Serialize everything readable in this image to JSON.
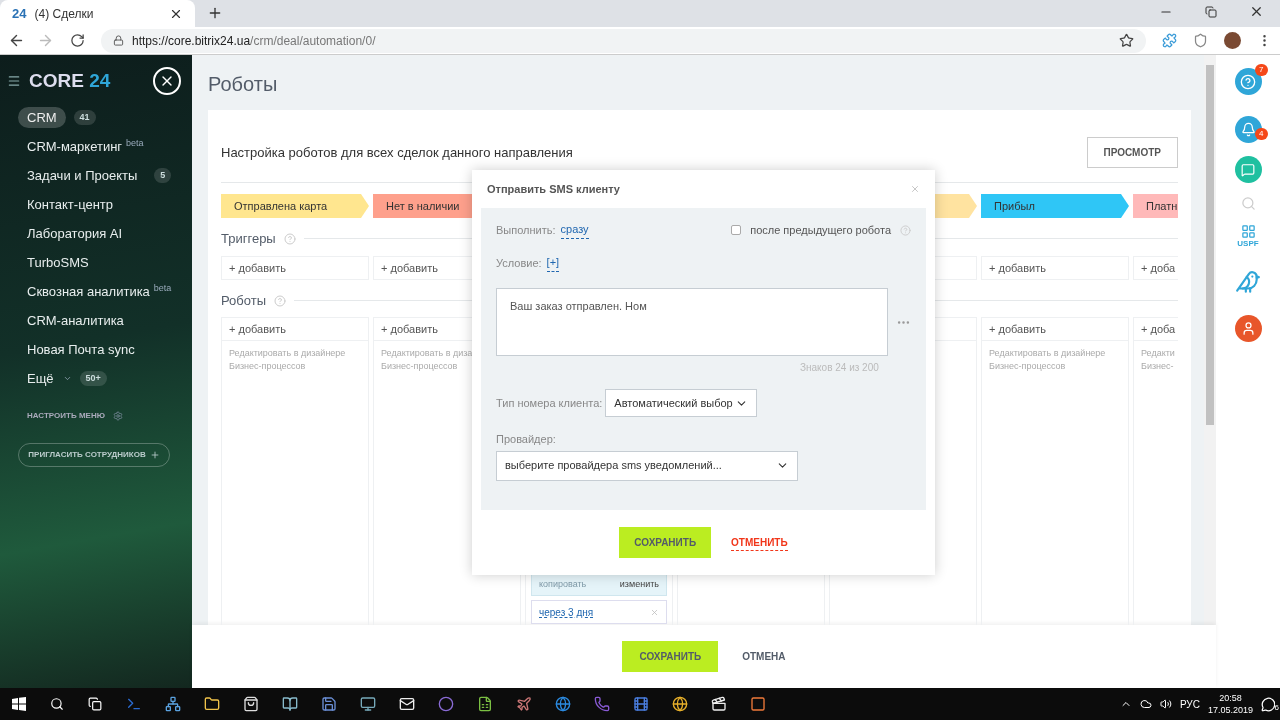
{
  "browser": {
    "tab": {
      "favicon": "24",
      "title": "(4) Сделки"
    },
    "url_host": "https://core.bitrix24.ua",
    "url_path": "/crm/deal/automation/0/"
  },
  "sidebar": {
    "logo_a": "CORE",
    "logo_b": "24",
    "items": [
      {
        "label": "CRM",
        "badge": "41",
        "selected": true,
        "dropdown": false
      },
      {
        "label": "CRM-маркетинг",
        "sup": "beta",
        "selected": false,
        "dropdown": false
      },
      {
        "label": "Задачи и Проекты",
        "badge": "5",
        "selected": false,
        "dropdown": false
      },
      {
        "label": "Контакт-центр",
        "selected": false,
        "dropdown": false
      },
      {
        "label": "Лаборатория AI",
        "selected": false,
        "dropdown": false
      },
      {
        "label": "TurboSMS",
        "selected": false,
        "dropdown": false
      },
      {
        "label": "Сквозная аналитика",
        "sup": "beta",
        "selected": false,
        "dropdown": false
      },
      {
        "label": "CRM-аналитика",
        "selected": false,
        "dropdown": false
      },
      {
        "label": "Новая Почта sync",
        "selected": false,
        "dropdown": false
      },
      {
        "label": "Ещё",
        "badge": "50+",
        "selected": false,
        "dropdown": true
      }
    ],
    "configure": "НАСТРОИТЬ МЕНЮ",
    "invite": "ПРИГЛАСИТЬ СОТРУДНИКОВ"
  },
  "page": {
    "title": "Роботы",
    "subtitle": "Настройка роботов для всех сделок данного направления",
    "preview_button": "ПРОСМОТР",
    "triggers_label": "Триггеры",
    "robots_label": "Роботы",
    "columns": [
      {
        "stage": {
          "label": "Отправлена карта",
          "color": "#ffe68f"
        },
        "trigger_add": "+ добавить",
        "robot_add": "+ добавить",
        "hint": [
          "Редактировать в дизайнере",
          "Бизнес-процессов"
        ]
      },
      {
        "stage": {
          "label": "Нет в наличии",
          "color": "#fea08c"
        },
        "trigger_add": "+ добавить",
        "robot_add": "+ добавить",
        "hint": [
          "Редактировать в диза",
          "Бизнес-процессов"
        ]
      },
      {
        "robot_card": {
          "action": "копировать",
          "edit": "изменить",
          "delay": "через 3 дня"
        }
      },
      {},
      {
        "stage": {
          "color": "#ffe3a0"
        }
      },
      {
        "stage": {
          "label": "Прибыл",
          "color": "#2fc6f6"
        },
        "trigger_add": "+ добавить",
        "robot_add": "+ добавить",
        "hint": [
          "Редактировать в дизайнере",
          "Бизнес-процессов"
        ]
      },
      {
        "stage": {
          "label": "Платн",
          "color": "#ffb9b9"
        },
        "trigger_add": "+ доба",
        "robot_add": "+ доба",
        "hint": [
          "Редакти",
          "Бизнес-"
        ]
      }
    ],
    "save": "СОХРАНИТЬ",
    "cancel": "ОТМЕНА"
  },
  "dialog": {
    "title": "Отправить SMS клиенту",
    "execute_label": "Выполнить:",
    "execute_value": "сразу",
    "after_previous": {
      "label": "после предыдущего робота",
      "checked": false
    },
    "condition_label": "Условие:",
    "condition_add": "[+]",
    "message": "Ваш заказ отправлен. Ном",
    "counter": "Знаков 24 из 200",
    "number_type_label": "Тип номера клиента:",
    "number_type": "Автоматический выбор",
    "provider_label": "Провайдер:",
    "provider": "выберите провайдера sms уведомлений...",
    "save": "СОХРАНИТЬ",
    "cancel": "ОТМЕНИТЬ"
  },
  "right_panel": {
    "help_badge": "7",
    "notifications_badge": "4",
    "logo": "USPF"
  },
  "taskbar": {
    "language": "РУС",
    "time": "20:58",
    "date": "17.05.2019",
    "notifications": "6"
  }
}
